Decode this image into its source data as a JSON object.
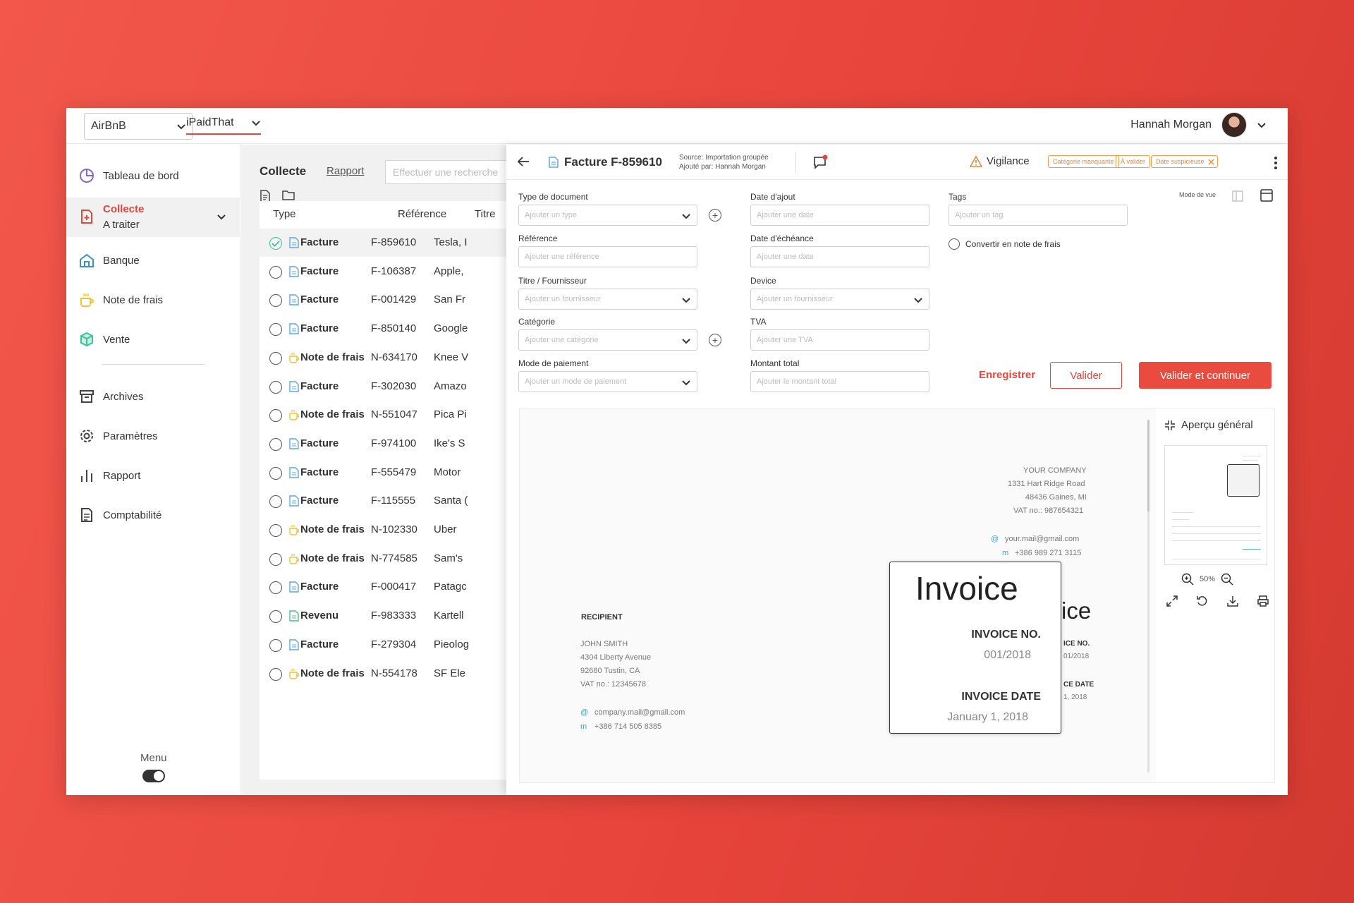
{
  "topbar": {
    "company": "AirBnB",
    "org": "iPaidThat",
    "user_name": "Hannah Morgan"
  },
  "sidebar": {
    "items": [
      {
        "label": "Tableau de bord",
        "icon": "pie-chart-icon"
      },
      {
        "label": "Collecte",
        "sublabel": "A traiter",
        "icon": "document-plus-icon"
      },
      {
        "label": "Banque",
        "icon": "bank-icon"
      },
      {
        "label": "Note de frais",
        "icon": "cup-icon"
      },
      {
        "label": "Vente",
        "icon": "box-icon"
      },
      {
        "label": "Archives",
        "icon": "archive-icon"
      },
      {
        "label": "Paramètres",
        "icon": "gear-icon"
      },
      {
        "label": "Rapport",
        "icon": "bar-chart-icon"
      },
      {
        "label": "Comptabilité",
        "icon": "ledger-icon"
      }
    ],
    "menu_label": "Menu"
  },
  "list": {
    "title": "Collecte",
    "rapport_link": "Rapport",
    "search_placeholder": "Effectuer une recherche",
    "columns": [
      "Type",
      "Référence",
      "Titre"
    ],
    "rows": [
      {
        "type": "Facture",
        "ref": "F-859610",
        "title": "Tesla, I",
        "kind": "facture",
        "checked": true
      },
      {
        "type": "Facture",
        "ref": "F-106387",
        "title": "Apple,",
        "kind": "facture"
      },
      {
        "type": "Facture",
        "ref": "F-001429",
        "title": "San Fr",
        "kind": "facture"
      },
      {
        "type": "Facture",
        "ref": "F-850140",
        "title": "Google",
        "kind": "facture"
      },
      {
        "type": "Note de frais",
        "ref": "N-634170",
        "title": "Knee V",
        "kind": "note"
      },
      {
        "type": "Facture",
        "ref": "F-302030",
        "title": "Amazo",
        "kind": "facture"
      },
      {
        "type": "Note de frais",
        "ref": "N-551047",
        "title": "Pica Pi",
        "kind": "note"
      },
      {
        "type": "Facture",
        "ref": "F-974100",
        "title": "Ike's S",
        "kind": "facture"
      },
      {
        "type": "Facture",
        "ref": "F-555479",
        "title": "Motor",
        "kind": "facture"
      },
      {
        "type": "Facture",
        "ref": "F-115555",
        "title": "Santa (",
        "kind": "facture"
      },
      {
        "type": "Note de frais",
        "ref": "N-102330",
        "title": "Uber",
        "kind": "note"
      },
      {
        "type": "Note de frais",
        "ref": "N-774585",
        "title": "Sam's",
        "kind": "note"
      },
      {
        "type": "Facture",
        "ref": "F-000417",
        "title": "Patagc",
        "kind": "facture"
      },
      {
        "type": "Revenu",
        "ref": "F-983333",
        "title": "Kartell",
        "kind": "revenu"
      },
      {
        "type": "Facture",
        "ref": "F-279304",
        "title": "Pieolog",
        "kind": "facture"
      },
      {
        "type": "Note de frais",
        "ref": "N-554178",
        "title": "SF Ele",
        "kind": "note"
      }
    ]
  },
  "detail": {
    "title": "Facture F-859610",
    "source": "Source: Importation groupée",
    "added_by": "Ajouté par: Hannah Morgan",
    "vigilance": "Vigilance",
    "tags": [
      "Catégorie manquante",
      "À valider",
      "Date suspicieuse"
    ],
    "fields": {
      "type_label": "Type de document",
      "type_ph": "Ajouter un type",
      "ref_label": "Référence",
      "ref_ph": "Ajouter une référence",
      "supplier_label": "Titre / Fournisseur",
      "supplier_ph": "Ajouter un fournisseur",
      "category_label": "Catégorie",
      "category_ph": "Ajouter une catégorie",
      "payment_label": "Mode de paiement",
      "payment_ph": "Ajouter un mode de paiement",
      "added_label": "Date d'ajout",
      "added_ph": "Ajouter une date",
      "due_label": "Date d'échéance",
      "due_ph": "Ajouter une date",
      "device_label": "Device",
      "device_ph": "Ajouter un fournisseur",
      "tva_label": "TVA",
      "tva_ph": "Ajouter une TVA",
      "total_label": "Montant total",
      "total_ph": "Ajouter le montant total",
      "tags_label": "Tags",
      "tags_ph": "Ajouter un tag",
      "mode_label": "Mode de vue",
      "convert_label": "Convertir en note de frais"
    },
    "buttons": {
      "save": "Enregistrer",
      "validate": "Valider",
      "validate_continue": "Valider et continuer"
    }
  },
  "preview": {
    "company": "YOUR COMPANY",
    "company_addr1": "1331 Hart Ridge Road",
    "company_addr2": "48436 Gaines, MI",
    "company_vat": "VAT no.: 987654321",
    "company_mail": "your.mail@gmail.com",
    "company_phone": "+386 989 271 3115",
    "recipient_label": "RECIPIENT",
    "recipient_name": "JOHN SMITH",
    "recipient_addr1": "4304 Liberty Avenue",
    "recipient_addr2": "92680 Tustin, CA",
    "recipient_vat": "VAT no.: 12345678",
    "recipient_mail": "company.mail@gmail.com",
    "recipient_phone": "+386 714 505 8385",
    "invoice_title": "Invoice",
    "invoice_no_label": "INVOICE NO.",
    "invoice_no": "001/2018",
    "invoice_date_label": "INVOICE DATE",
    "invoice_date": "January 1, 2018",
    "bg_title_tail": "ice",
    "bg_no_label_tail": "ICE NO.",
    "bg_no_tail": "01/2018",
    "bg_date_label_tail": "CE DATE",
    "bg_date_tail": "1, 2018",
    "at_glyph": "@",
    "m_glyph": "m",
    "overview_title": "Aperçu général",
    "zoom_level": "50%"
  },
  "colors": {
    "accent": "#e8453c",
    "warning": "#e8863b",
    "check": "#3cc09b",
    "doc_blue": "#5aa9e6",
    "note_yellow": "#f2c232",
    "revenue_green": "#4cc08a"
  }
}
